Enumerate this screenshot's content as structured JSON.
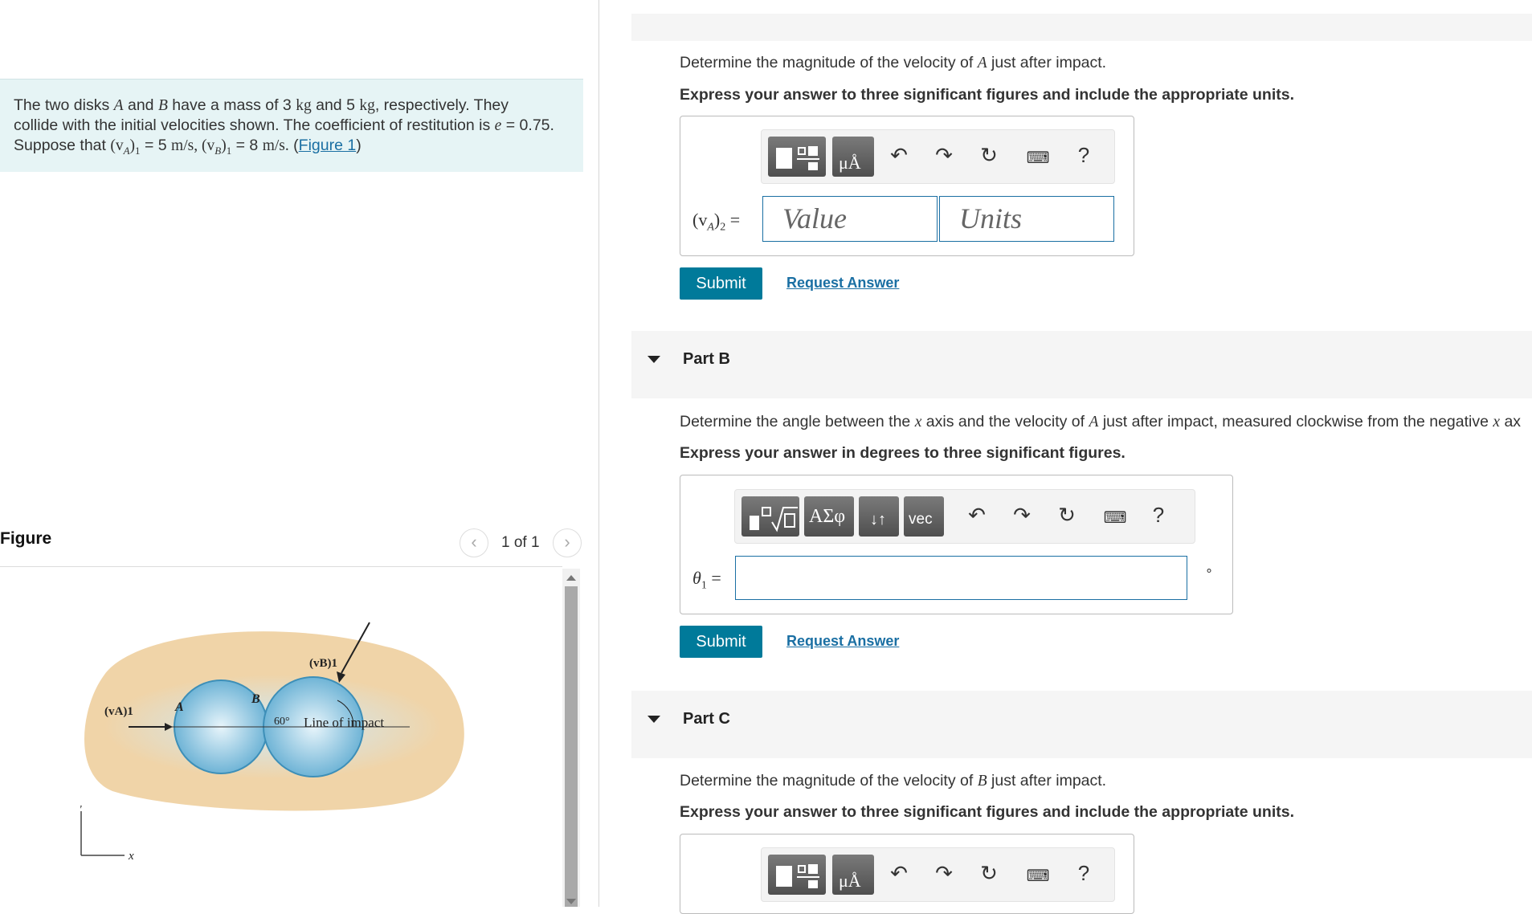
{
  "problem": {
    "text_part1": "The two disks ",
    "var_a": "A",
    "text_part2": " and ",
    "var_b": "B",
    "text_part3": " have a mass of 3 ",
    "unit_kg": "kg",
    "text_part4": " and 5 ",
    "unit_kg2": "kg",
    "text_part5": ", respectively. They",
    "line2": "collide with the initial velocities shown. The coefficient of restitution is ",
    "var_e": "e",
    "line2_end": " = 0.75.",
    "line3_start": "Suppose that ",
    "va1": "(v",
    "va1_sub": "A",
    "va1_end": ")",
    "va1_sub2": "1",
    "va1_val": " = 5 ",
    "unit_ms": "m/s",
    "comma": ", ",
    "vb1": "(v",
    "vb1_sub": "B",
    "vb1_end": ")",
    "vb1_sub2": "1",
    "vb1_val": " = 8 ",
    "unit_ms2": "m/s.",
    "figure_link_open": " (",
    "figure_link": "Figure 1",
    "figure_link_close": ")"
  },
  "figure_panel": {
    "title": "Figure",
    "pager": "1 of 1",
    "prev": "‹",
    "next": "›",
    "labels": {
      "vb1": "(vB)1",
      "va1": "(vA)1",
      "a": "A",
      "b": "B",
      "angle": "60°",
      "line_of_impact": "Line of impact",
      "y": "y",
      "x": "x"
    }
  },
  "partA": {
    "question_pre": "Determine the magnitude of the velocity of ",
    "question_var": "A",
    "question_post": " just after impact.",
    "instruction": "Express your answer to three significant figures and include the appropriate units.",
    "label_main": "(v",
    "label_sub": "A",
    "label_end": ")",
    "label_sub2": "2",
    "label_eq": " =",
    "value_placeholder": "Value",
    "units_placeholder": "Units",
    "submit": "Submit",
    "request": "Request Answer",
    "help": "?"
  },
  "partB": {
    "title": "Part B",
    "question_pre": "Determine the angle between the ",
    "question_var1": "x",
    "question_mid": " axis and the velocity of ",
    "question_var2": "A",
    "question_post": " just after impact, measured clockwise from the negative ",
    "question_var3": "x",
    "question_tail": " ax",
    "instruction": "Express your answer in degrees to three significant figures.",
    "label": "θ",
    "label_sub": "1",
    "label_eq": " =",
    "unit": "∘",
    "btn_greek": "ΑΣφ",
    "btn_vec": "vec",
    "submit": "Submit",
    "request": "Request Answer",
    "help": "?"
  },
  "partC": {
    "title": "Part C",
    "question_pre": "Determine the magnitude of the velocity of ",
    "question_var": "B",
    "question_post": " just after impact.",
    "instruction": "Express your answer to three significant figures and include the appropriate units.",
    "help": "?"
  },
  "colors": {
    "accent": "#007a9a",
    "link": "#1a6fa3",
    "problem_bg": "#e6f4f5",
    "figure_bg": "#f0d4a8",
    "disk": "#7fc0de"
  }
}
